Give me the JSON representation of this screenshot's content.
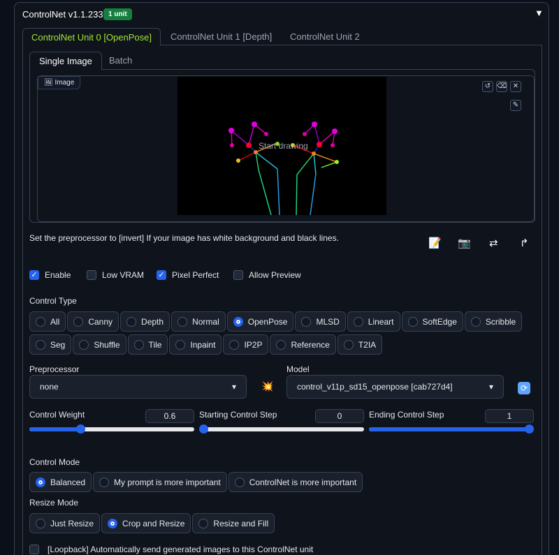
{
  "header": {
    "title": "ControlNet v1.1.233",
    "badge": "1 unit",
    "collapse_icon": "triangle-down"
  },
  "tabs": [
    {
      "label": "ControlNet Unit 0 [OpenPose]",
      "active": true
    },
    {
      "label": "ControlNet Unit 1 [Depth]"
    },
    {
      "label": "ControlNet Unit 2"
    }
  ],
  "subtabs": [
    {
      "label": "Single Image",
      "active": true
    },
    {
      "label": "Batch"
    }
  ],
  "image": {
    "label": "Image",
    "overlay_text": "Start drawing"
  },
  "hint": "Set the preprocessor to [invert] If your image has white background and black lines.",
  "checkboxes": [
    {
      "label": "Enable",
      "checked": true
    },
    {
      "label": "Low VRAM",
      "checked": false
    },
    {
      "label": "Pixel Perfect",
      "checked": true
    },
    {
      "label": "Allow Preview",
      "checked": false
    }
  ],
  "control_type": {
    "label": "Control Type",
    "row1": [
      "All",
      "Canny",
      "Depth",
      "Normal",
      "OpenPose",
      "MLSD",
      "Lineart",
      "SoftEdge",
      "Scribble"
    ],
    "row2": [
      "Seg",
      "Shuffle",
      "Tile",
      "Inpaint",
      "IP2P",
      "Reference",
      "T2IA"
    ],
    "selected": "OpenPose"
  },
  "preprocessor": {
    "label": "Preprocessor",
    "value": "none"
  },
  "model": {
    "label": "Model",
    "value": "control_v11p_sd15_openpose [cab727d4]"
  },
  "sliders": [
    {
      "label": "Control Weight",
      "value": "0.6",
      "fraction": 0.3
    },
    {
      "label": "Starting Control Step",
      "value": "0",
      "fraction": 0
    },
    {
      "label": "Ending Control Step",
      "value": "1",
      "fraction": 1
    }
  ],
  "control_mode": {
    "label": "Control Mode",
    "options": [
      "Balanced",
      "My prompt is more important",
      "ControlNet is more important"
    ],
    "selected": "Balanced"
  },
  "resize_mode": {
    "label": "Resize Mode",
    "options": [
      "Just Resize",
      "Crop and Resize",
      "Resize and Fill"
    ],
    "selected": "Crop and Resize"
  },
  "loopback": {
    "label": "[Loopback] Automatically send generated images to this ControlNet unit",
    "checked": false
  },
  "colors": {
    "accent": "#2563eb",
    "active_tab": "#a3e635",
    "badge": "#15803d"
  }
}
